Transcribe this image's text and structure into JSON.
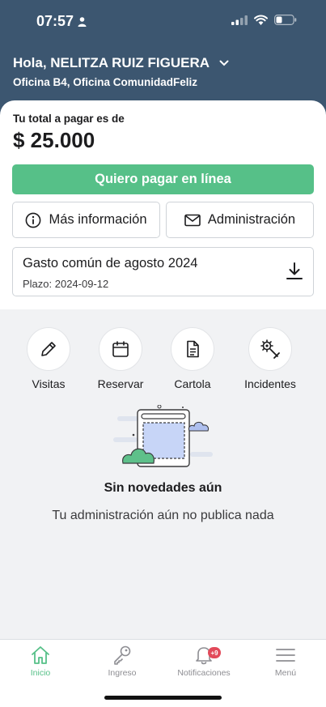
{
  "status_bar": {
    "time": "07:57"
  },
  "header": {
    "greeting": "Hola, NELITZA RUIZ FIGUERA",
    "unit": "Oficina B4, Oficina ComunidadFeliz"
  },
  "payment": {
    "total_label": "Tu total a pagar es de",
    "amount": "$ 25.000",
    "pay_button": "Quiero pagar en línea",
    "info_button": "Más información",
    "admin_button": "Administración"
  },
  "expense": {
    "title": "Gasto común de agosto 2024",
    "due": "Plazo: 2024-09-12"
  },
  "quick_actions": [
    {
      "label": "Visitas",
      "icon": "pencil-icon"
    },
    {
      "label": "Reservar",
      "icon": "calendar-icon"
    },
    {
      "label": "Cartola",
      "icon": "document-icon"
    },
    {
      "label": "Incidentes",
      "icon": "wrench-gear-icon"
    }
  ],
  "empty_state": {
    "title": "Sin novedades aún",
    "subtitle": "Tu administración aún no publica nada"
  },
  "tabbar": {
    "items": [
      {
        "label": "Inicio",
        "icon": "home-icon",
        "active": true
      },
      {
        "label": "Ingreso",
        "icon": "key-icon",
        "active": false
      },
      {
        "label": "Notificaciones",
        "icon": "bell-icon",
        "active": false,
        "badge": "+9"
      },
      {
        "label": "Menú",
        "icon": "hamburger-menu-icon",
        "active": false
      }
    ]
  },
  "colors": {
    "header_bg": "#3c5670",
    "accent_green": "#56c088",
    "badge_red": "#e24a5a"
  }
}
